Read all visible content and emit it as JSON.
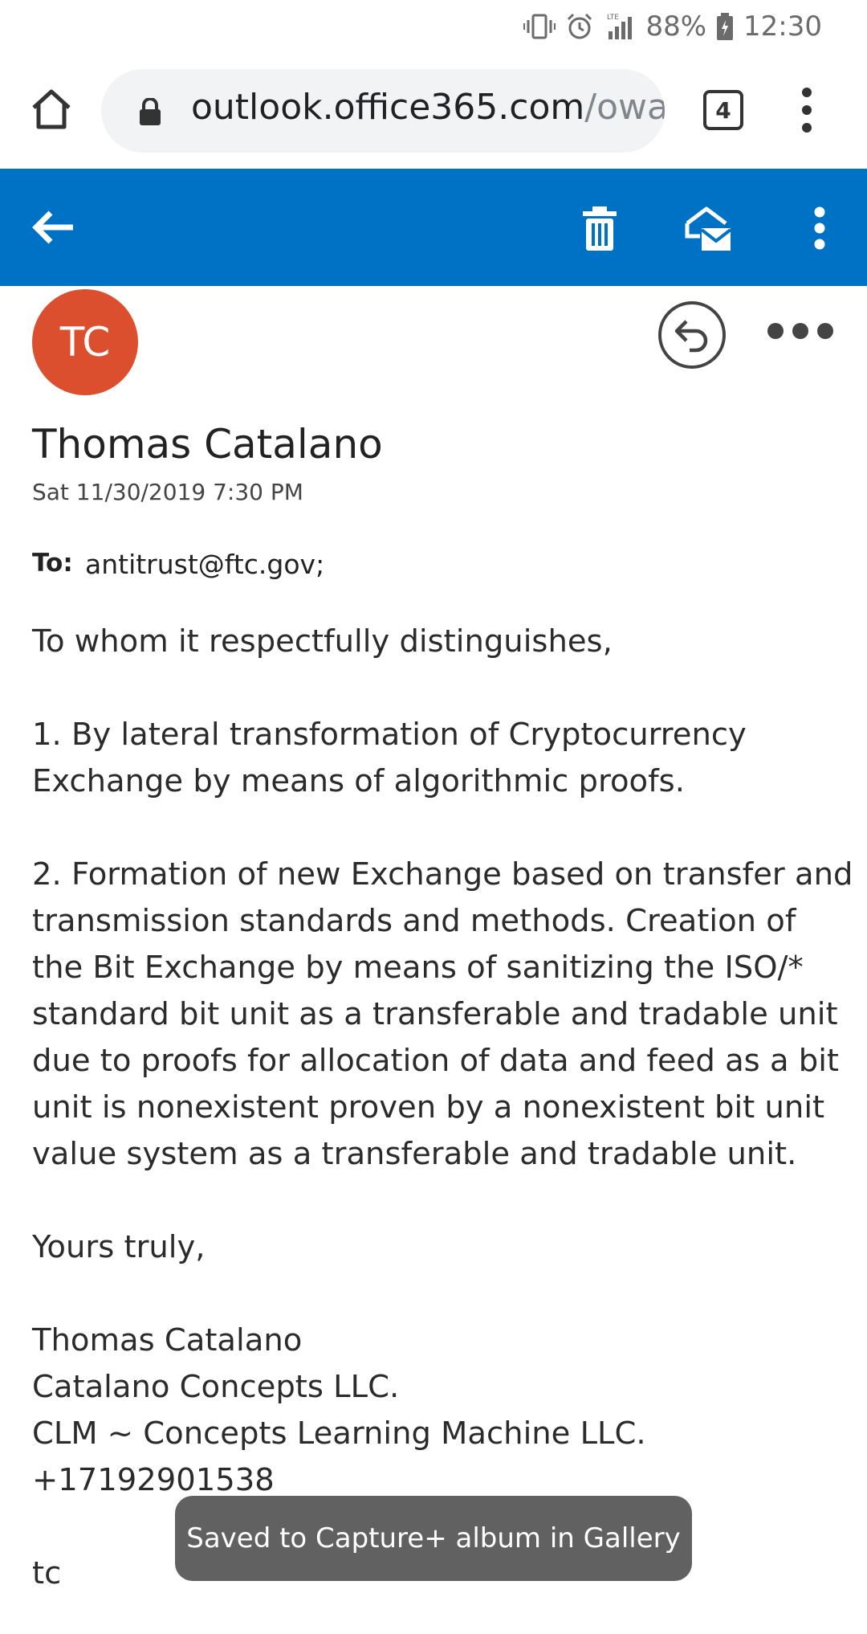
{
  "status_bar": {
    "battery": "88%",
    "time": "12:30",
    "network_label": "LTE",
    "icons": [
      "vibrate-icon",
      "alarm-icon",
      "signal-icon",
      "battery-icon"
    ]
  },
  "browser": {
    "url_host": "outlook.office365.com",
    "url_path": "/owa/",
    "tab_count": "4",
    "icons": [
      "home-icon",
      "lock-icon",
      "overflow-menu-icon"
    ]
  },
  "toolbar": {
    "icons": [
      "back-arrow-icon",
      "trash-icon",
      "mark-read-icon",
      "more-vertical-icon"
    ],
    "background": "#0072c6"
  },
  "message": {
    "avatar_initials": "TC",
    "avatar_color": "#dc4f2e",
    "sender": "Thomas Catalano",
    "date": "Sat 11/30/2019 7:30 PM",
    "to_label": "To:",
    "to_value": "antitrust@ftc.gov;"
  },
  "body": {
    "greeting": "To whom it respectfully distinguishes,",
    "point1": [
      "1. By lateral transformation of Cryptocurrency",
      "Exchange by means of algorithmic proofs."
    ],
    "point2": [
      "2. Formation of new Exchange based on transfer and",
      "transmission standards and methods. Creation of",
      "the Bit Exchange by means of sanitizing the ISO/*",
      "standard bit unit as a transferable and tradable unit",
      "due to proofs for allocation of data and feed as a bit",
      "unit is nonexistent proven by a nonexistent bit unit",
      "value system as a transferable and tradable unit."
    ],
    "closing": "Yours truly,",
    "signature": [
      "Thomas Catalano",
      "Catalano Concepts LLC.",
      "CLM ~ Concepts Learning Machine LLC.",
      "+17192901538"
    ],
    "initials": "tc"
  },
  "toast": {
    "text": "Saved to Capture+ album in Gallery"
  }
}
